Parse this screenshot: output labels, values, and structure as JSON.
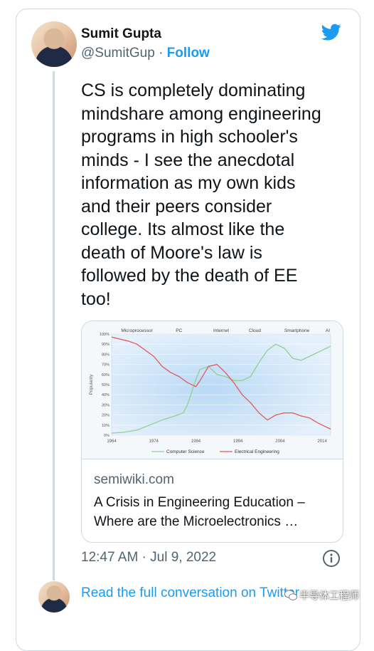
{
  "tweet": {
    "author_name": "Sumit Gupta",
    "handle": "@SumitGup",
    "separator": "·",
    "follow_label": "Follow",
    "text": "CS is completely dominating\nmindshare among engineering\nprograms in high schooler's\nminds - I see the anecdotal\ninformation as my own kids\nand their peers consider\ncollege. Its almost like the\ndeath of Moore's law is\nfollowed by the death of EE\ntoo!",
    "timestamp": "12:47 AM · Jul 9, 2022",
    "read_more": "Read the full conversation on Twitter"
  },
  "link_card": {
    "domain": "semiwiki.com",
    "title": "A Crisis in Engineering Education –\nWhere are the Microelectronics …"
  },
  "watermark": {
    "text": "半导体工程师"
  },
  "icons": {
    "brand": "twitter-bird-icon",
    "info": "info-icon",
    "watermark": "wechat-logo-icon"
  },
  "colors": {
    "accent": "#1d9bf0",
    "cs_line": "#8fd18f",
    "ee_line": "#e05a5a"
  },
  "chart_data": {
    "type": "line",
    "ylabel": "Popularity",
    "x_ticks": [
      1964,
      1974,
      1984,
      1994,
      2004,
      2014
    ],
    "y_ticks": [
      "0%",
      "10%",
      "20%",
      "30%",
      "40%",
      "50%",
      "60%",
      "70%",
      "80%",
      "90%",
      "100%"
    ],
    "ylim": [
      0,
      100
    ],
    "xlim": [
      1964,
      2016
    ],
    "eras": [
      {
        "label": "Microprocessor",
        "year": 1970
      },
      {
        "label": "PC",
        "year": 1980
      },
      {
        "label": "Internet",
        "year": 1990
      },
      {
        "label": "Cloud",
        "year": 1998
      },
      {
        "label": "Smartphone",
        "year": 2008
      },
      {
        "label": "AI",
        "year": 2016
      }
    ],
    "series": [
      {
        "name": "Computer Science",
        "color": "#8fd18f",
        "x": [
          1964,
          1967,
          1970,
          1973,
          1976,
          1979,
          1981,
          1982,
          1984,
          1985,
          1987,
          1989,
          1991,
          1993,
          1995,
          1997,
          1999,
          2001,
          2003,
          2005,
          2007,
          2009,
          2011,
          2013,
          2016
        ],
        "y": [
          2,
          3,
          5,
          10,
          15,
          19,
          22,
          30,
          55,
          65,
          68,
          60,
          58,
          54,
          54,
          58,
          72,
          84,
          90,
          86,
          76,
          74,
          78,
          82,
          88
        ]
      },
      {
        "name": "Electrical Engineering",
        "color": "#e05a5a",
        "x": [
          1964,
          1966,
          1968,
          1970,
          1972,
          1974,
          1976,
          1978,
          1980,
          1982,
          1984,
          1985,
          1987,
          1989,
          1991,
          1993,
          1995,
          1997,
          1999,
          2001,
          2003,
          2005,
          2007,
          2009,
          2011,
          2013,
          2016
        ],
        "y": [
          97,
          95,
          93,
          90,
          84,
          78,
          68,
          62,
          58,
          52,
          48,
          54,
          68,
          70,
          62,
          52,
          40,
          32,
          22,
          15,
          20,
          22,
          22,
          19,
          17,
          12,
          6
        ]
      }
    ]
  }
}
